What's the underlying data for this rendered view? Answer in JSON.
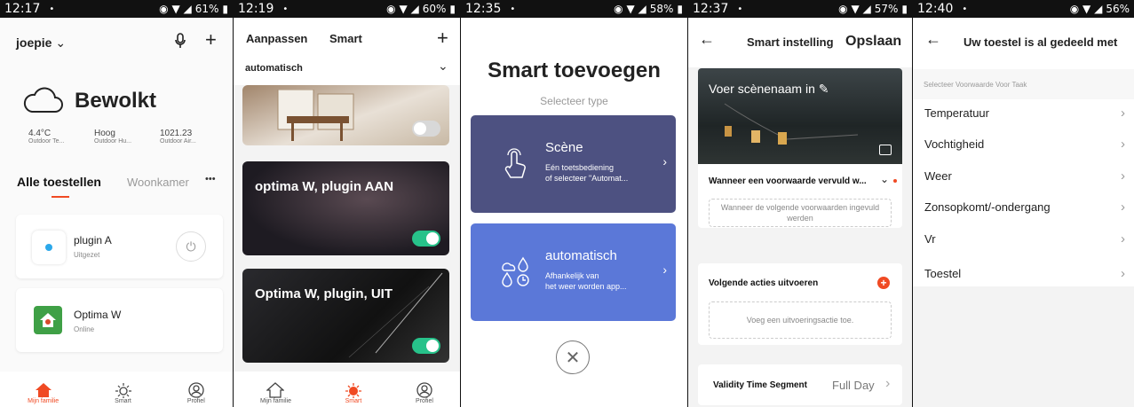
{
  "panels": {
    "p1": {
      "status": {
        "time": "12:17",
        "battery": "61%"
      },
      "header": {
        "user": "joepie"
      },
      "weather": {
        "condition": "Bewolkt",
        "stats": [
          {
            "value": "4.4°C",
            "label": "Outdoor Te..."
          },
          {
            "value": "Hoog",
            "label": "Outdoor Hu..."
          },
          {
            "value": "1021.23",
            "label": "Outdoor Air..."
          }
        ]
      },
      "tabs": {
        "active": "Alle toestellen",
        "other": "Woonkamer",
        "more": "•••"
      },
      "devices": [
        {
          "name": "plugin A",
          "status": "Uitgezet"
        },
        {
          "name": "Optima W",
          "status": "Online"
        }
      ],
      "nav": [
        "Mijn familie",
        "Smart",
        "Profiel"
      ]
    },
    "p2": {
      "status": {
        "time": "12:19",
        "battery": "60%"
      },
      "header": {
        "left": "Aanpassen",
        "center": "Smart",
        "plus": "+"
      },
      "filter": "automatisch",
      "scenes": [
        {
          "title": "",
          "enabled": false
        },
        {
          "title": "optima W, plugin AAN",
          "enabled": true
        },
        {
          "title": "Optima W, plugin, UIT",
          "enabled": true
        }
      ],
      "nav": [
        "Mijn familie",
        "Smart",
        "Profiel"
      ]
    },
    "p3": {
      "status": {
        "time": "12:35",
        "battery": "58%"
      },
      "title": "Smart toevoegen",
      "subtitle": "Selecteer type",
      "cards": [
        {
          "title": "Scène",
          "desc1": "Eén toetsbediening",
          "desc2": "of selecteer \"Automat..."
        },
        {
          "title": "automatisch",
          "desc1": "Afhankelijk van",
          "desc2": "het weer worden app..."
        }
      ],
      "colors": {
        "card1": "#4d5181",
        "card2": "#5b78d8"
      }
    },
    "p4": {
      "status": {
        "time": "12:37",
        "battery": "57%"
      },
      "header": {
        "title": "Smart instelling",
        "save": "Opslaan"
      },
      "scene_name": "Voer scènenaam in",
      "condition": {
        "title": "Wanneer een voorwaarde vervuld w...",
        "placeholder": "Wanneer de volgende voorwaarden ingevuld werden"
      },
      "actions": {
        "title": "Volgende acties uitvoeren",
        "placeholder": "Voeg een uitvoeringsactie toe."
      },
      "validity": {
        "label": "Validity Time Segment",
        "value": "Full Day"
      }
    },
    "p5": {
      "status": {
        "time": "12:40",
        "battery": "56%"
      },
      "header": {
        "title": "Uw toestel is al gedeeld met"
      },
      "section": "Selecteer Voorwaarde Voor Taak",
      "items": [
        "Temperatuur",
        "Vochtigheid",
        "Weer",
        "Zonsopkomt/-ondergang",
        "Vr",
        "Toestel"
      ]
    }
  },
  "accent": "#f04a23",
  "toggle_on": "#27c28a"
}
